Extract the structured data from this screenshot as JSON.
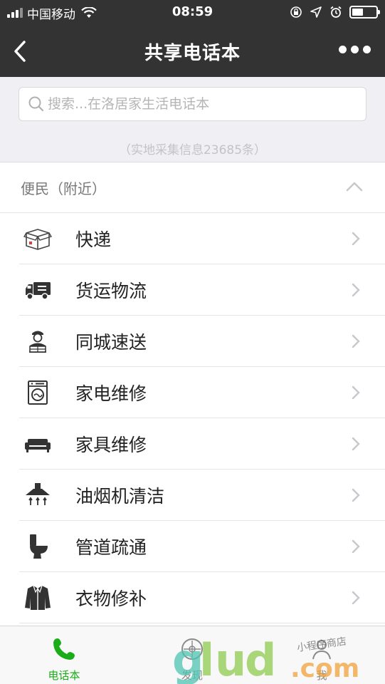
{
  "status_bar": {
    "carrier": "中国移动",
    "time": "08:59"
  },
  "nav": {
    "title": "共享电话本"
  },
  "search": {
    "placeholder": "搜索...在洛居家生活电话本",
    "value": ""
  },
  "record_count": "（实地采集信息23685条）",
  "section": {
    "title": "便民（附近）",
    "expanded": true
  },
  "items": [
    {
      "label": "快递",
      "icon": "express-box-icon"
    },
    {
      "label": "货运物流",
      "icon": "truck-icon"
    },
    {
      "label": "同城速送",
      "icon": "courier-icon"
    },
    {
      "label": "家电维修",
      "icon": "washing-machine-icon"
    },
    {
      "label": "家具维修",
      "icon": "sofa-icon"
    },
    {
      "label": "油烟机清洁",
      "icon": "range-hood-icon"
    },
    {
      "label": "管道疏通",
      "icon": "toilet-icon"
    },
    {
      "label": "衣物修补",
      "icon": "jacket-icon"
    }
  ],
  "tabs": [
    {
      "label": "电话本",
      "icon": "phone-icon",
      "active": true
    },
    {
      "label": "发现",
      "icon": "compass-icon",
      "active": false
    },
    {
      "label": "我",
      "icon": "person-icon",
      "active": false
    }
  ],
  "watermark": {
    "text": "glud.com",
    "handwriting": "小程序商店"
  },
  "colors": {
    "header_bg": "#333333",
    "active_tab": "#1aad19",
    "icon_dark": "#333333"
  }
}
